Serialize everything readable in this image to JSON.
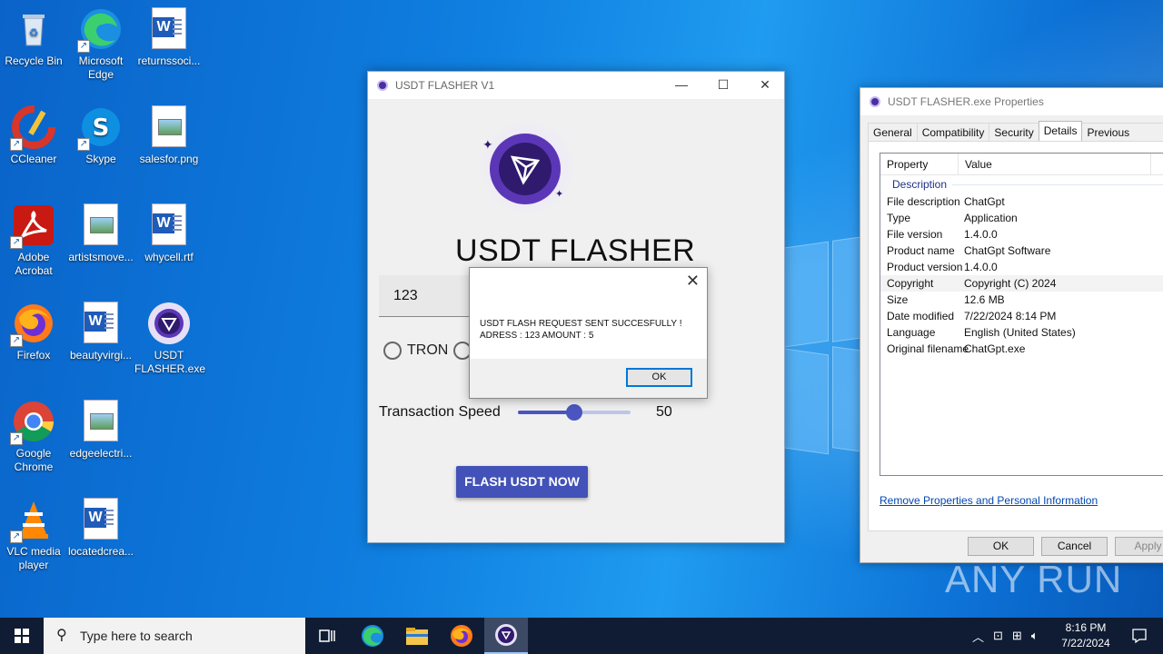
{
  "desktop": {
    "icons": [
      {
        "label": "Recycle Bin"
      },
      {
        "label": "Microsoft Edge"
      },
      {
        "label": "returnssoci..."
      },
      {
        "label": "CCleaner"
      },
      {
        "label": "Skype"
      },
      {
        "label": "salesfor.png"
      },
      {
        "label": "Adobe Acrobat"
      },
      {
        "label": "artistsmove..."
      },
      {
        "label": "whycell.rtf"
      },
      {
        "label": "Firefox"
      },
      {
        "label": "beautyvirgi..."
      },
      {
        "label": "USDT FLASHER.exe"
      },
      {
        "label": "Google Chrome"
      },
      {
        "label": "edgeelectri..."
      },
      {
        "label": "VLC media player"
      },
      {
        "label": "locatedcrea..."
      }
    ]
  },
  "app": {
    "title": "USDT FLASHER V1",
    "heading": "USDT FLASHER",
    "amount_value": "123",
    "radio_tron": "TRON",
    "speed_label": "Transaction Speed",
    "speed_value": "50",
    "speed_fraction": 0.5,
    "flash_button": "FLASH USDT NOW",
    "accent_color": "#4352b8"
  },
  "dialog": {
    "close": "✕",
    "line1": "USDT FLASH REQUEST SENT SUCCESFULLY !",
    "line2": "ADRESS : 123 AMOUNT : 5",
    "ok": "OK"
  },
  "properties": {
    "title": "USDT FLASHER.exe Properties",
    "tabs": [
      "General",
      "Compatibility",
      "Security",
      "Details",
      "Previous Versions"
    ],
    "col_property": "Property",
    "col_value": "Value",
    "section": "Description",
    "rows": [
      {
        "k": "File description",
        "v": "ChatGpt"
      },
      {
        "k": "Type",
        "v": "Application"
      },
      {
        "k": "File version",
        "v": "1.4.0.0"
      },
      {
        "k": "Product name",
        "v": "ChatGpt Software"
      },
      {
        "k": "Product version",
        "v": "1.4.0.0"
      },
      {
        "k": "Copyright",
        "v": "Copyright (C) 2024"
      },
      {
        "k": "Size",
        "v": "12.6 MB"
      },
      {
        "k": "Date modified",
        "v": "7/22/2024 8:14 PM"
      },
      {
        "k": "Language",
        "v": "English (United States)"
      },
      {
        "k": "Original filename",
        "v": "ChatGpt.exe"
      }
    ],
    "link": "Remove Properties and Personal Information",
    "ok": "OK",
    "cancel": "Cancel",
    "apply": "Apply"
  },
  "watermark": "ANY RUN",
  "taskbar": {
    "search_placeholder": "Type here to search",
    "time": "8:16 PM",
    "date": "7/22/2024"
  }
}
